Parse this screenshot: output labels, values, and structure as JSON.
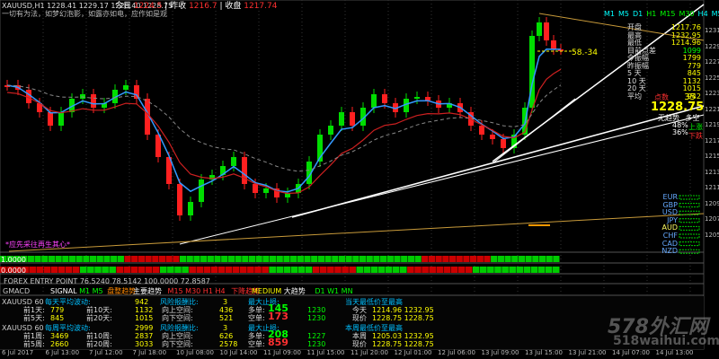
{
  "header": {
    "symbol_line": "XAUUSD,H1  1228.41 1229.17 1228.40 1228.75",
    "subtitle": "一切有为法，如梦幻泡影，如露亦如电，应作如是观",
    "today_label": "今日",
    "today_value": "1224.5",
    "yesterday_label": "昨收",
    "yesterday_value": "1216.7",
    "close_label": "收盘",
    "close_value": "1217.74"
  },
  "timeframes": [
    "M1",
    "M5",
    "D1",
    "H1",
    "M15",
    "M30",
    "H4",
    "M5",
    "M1"
  ],
  "stats_panel": {
    "rows": [
      {
        "label": "开盘",
        "value": "1217.76",
        "color": "#ffff00"
      },
      {
        "label": "最高",
        "value": "1232.95",
        "color": "#ffff00"
      },
      {
        "label": "最低",
        "value": "1214.96",
        "color": "#ffff00"
      },
      {
        "label": "目前点差",
        "value": "1099",
        "color": "#00ff00"
      },
      {
        "label": "今振幅",
        "value": "1799",
        "color": "#ffff00"
      },
      {
        "label": "昨振幅",
        "value": "779",
        "color": "#ffff00"
      },
      {
        "label": "5 天",
        "value": "845",
        "color": "#ffff00"
      },
      {
        "label": "10 天",
        "value": "1132",
        "color": "#ffff00"
      },
      {
        "label": "20 天",
        "value": "1015",
        "color": "#ffff00"
      },
      {
        "label": "平均",
        "value": "942",
        "color": "#ffff00"
      }
    ],
    "points_label": "点数",
    "points_value": "35",
    "price": "1228.75",
    "trend_label": "无趋势",
    "trend_value": "多空",
    "pct_a": "48%",
    "pct_b": "36%",
    "side_a": "上涨",
    "side_b": "下跌"
  },
  "target_label": "58.-34",
  "currencies": [
    "EUR",
    "GBP",
    "USD",
    "JPY",
    "AUD",
    "CHF",
    "CAD",
    "NZD"
  ],
  "annotation": "*应先采往再生其心*",
  "right_axis": [
    "1231",
    "1229",
    "1227",
    "1225",
    "1223",
    "1221",
    "1219",
    "1217",
    "1215",
    "1213",
    "1211",
    "1209",
    "1207",
    "1205"
  ],
  "indicator_rows": {
    "row1_value": "1.0000",
    "row2_value": "0.0000",
    "forex_line": "FOREX ENTRY POINT 76.5240 78.5142 100.0000 72.8587"
  },
  "legend_row": {
    "gmacd": "GMACD",
    "signal": "SIGNAL",
    "signal_tf": "M1 M5",
    "trend_label": "盘整趋势",
    "main_trend": "主要趋势",
    "main_tf": "M15 M30 H1 H4",
    "down_trend": "下降趋势",
    "medium": "MEDIUM",
    "medium_trend": "大趋势",
    "d1w1": "D1 W1 MN"
  },
  "bottom_panel": {
    "section1": {
      "symbol": "XAUUSD 60",
      "avg_label": "每天平均波动:",
      "avg_value": "942",
      "risk_label": "风险报酬比:",
      "risk_value": "3",
      "max_label": "最大止损:",
      "rows": [
        {
          "a_label": "前1天:",
          "a_value": "779",
          "b_label": "前10天:",
          "b_value": "1132",
          "c_label": "向上空间:",
          "c_value": "436",
          "d_label": "多单:",
          "d_value": "145",
          "e_value": "1230",
          "f_label": "今天",
          "f_value": "1214.96 1232.95"
        },
        {
          "a_label": "前5天:",
          "a_value": "845",
          "b_label": "前20天:",
          "b_value": "1015",
          "c_label": "向下空间:",
          "c_value": "521",
          "d_label": "空单:",
          "d_value": "173",
          "e_value": "1230",
          "f_label": "现价",
          "f_value": "1228.75 1228.75"
        }
      ],
      "title_right": "当天最低价至最高"
    },
    "section2": {
      "symbol": "XAUUSD 60",
      "avg_label": "每周平均波动:",
      "avg_value": "2999",
      "risk_label": "风险报酬比:",
      "risk_value": "3",
      "max_label": "最大止损:",
      "rows": [
        {
          "a_label": "前1周:",
          "a_value": "3469",
          "b_label": "前10周:",
          "b_value": "2837",
          "c_label": "向上空间:",
          "c_value": "626",
          "d_label": "多单:",
          "d_value": "208",
          "e_value": "1227",
          "f_label": "本周",
          "f_value": "1205.03 1232.95"
        },
        {
          "a_label": "前5周:",
          "a_value": "2660",
          "b_label": "前20周:",
          "b_value": "3033",
          "c_label": "向下空间:",
          "c_value": "2578",
          "d_label": "空单:",
          "d_value": "859",
          "e_value": "1230",
          "f_label": "现价",
          "f_value": "1228.75 1228.75"
        }
      ],
      "title_right": "本周最低价至最高"
    }
  },
  "watermark": {
    "main": "578外汇网",
    "url": "518waihui.com"
  },
  "time_axis": [
    "6 Jul 2017",
    "6 Jul 13:00",
    "7 Jul 12:00",
    "7 Jul 18:00",
    "10 Jul 08:00",
    "10 Jul 14:00",
    "11 Jul 09:00",
    "11 Jul 15:00",
    "11 Jul 20:00",
    "12 Jul 01:00",
    "12 Jul 06:00",
    "13 Jul 09:00",
    "13 Jul 15:00",
    "13 Jul 21:00",
    "14 Jul 07:00",
    "14 Jul 13:00"
  ],
  "colors": {
    "bull": "#00dd00",
    "bear": "#ff2020",
    "ma_blue": "#3399ff",
    "ma_red": "#cc2020",
    "ma_gray": "#888888",
    "trend_white": "#ffffff",
    "trend_orange": "#c89a3a"
  }
}
